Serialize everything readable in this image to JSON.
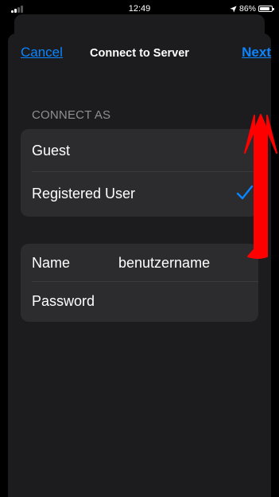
{
  "status_bar": {
    "time": "12:49",
    "battery_text": "86%",
    "battery_level": 0.86,
    "icons": [
      "signal-icon",
      "location-arrow-icon",
      "battery-icon"
    ]
  },
  "nav": {
    "cancel_label": "Cancel",
    "title": "Connect to Server",
    "next_label": "Next"
  },
  "connect_as": {
    "header": "CONNECT AS",
    "options": [
      {
        "label": "Guest",
        "selected": false
      },
      {
        "label": "Registered User",
        "selected": true
      }
    ]
  },
  "credentials": {
    "name_label": "Name",
    "name_value": "benutzername",
    "password_label": "Password",
    "password_value": ""
  },
  "colors": {
    "accent": "#0a84ff",
    "annotation_arrow": "#ff0000",
    "sheet_background": "#1c1c1e",
    "group_background": "#2c2c2e"
  }
}
